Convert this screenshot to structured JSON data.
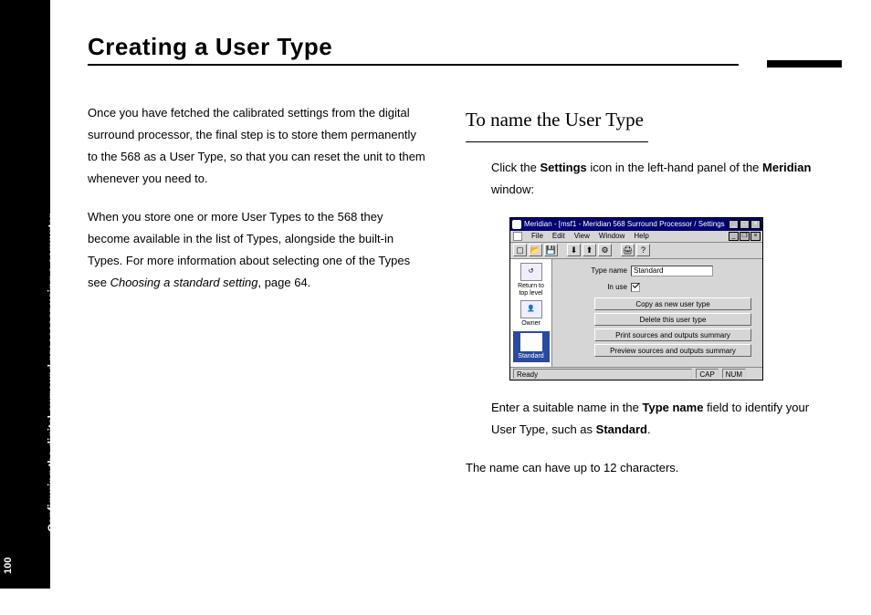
{
  "page_number": "100",
  "sidebar_label": "Configuring the digital surround processor using a computer",
  "heading": "Creating a User Type",
  "left_column": {
    "para1": "Once you have fetched the calibrated settings from the digital surround processor, the final step is to store them permanently to the 568 as a User Type, so that you can reset the unit to them whenever you need to.",
    "para2_prefix": "When you store one or more User Types to the 568 they become available in the list of Types, alongside the built-in Types. For more information about selecting one of the Types see ",
    "para2_italic": "Choosing a standard setting",
    "para2_suffix": ", page 64."
  },
  "right_column": {
    "subheading": "To name the User Type",
    "click_prefix": "Click the ",
    "click_bold1": "Settings",
    "click_mid": " icon in the left-hand panel of the ",
    "click_bold2": "Meridian",
    "click_suffix": " window:",
    "enter_prefix": "Enter a suitable name in the ",
    "enter_bold1": "Type name",
    "enter_mid": " field to identify your User Type, such as ",
    "enter_bold2": "Standard",
    "enter_suffix": ".",
    "limit": "The name can have up to 12 characters."
  },
  "app": {
    "title": "Meridian - [msf1 - Meridian 568 Surround Processor / Settings ]",
    "menu": {
      "file": "File",
      "edit": "Edit",
      "view": "View",
      "window": "Window",
      "help": "Help"
    },
    "form": {
      "type_name_label": "Type name",
      "type_name_value": "Standard",
      "in_use_label": "In use",
      "btn_copy": "Copy as new user type",
      "btn_delete": "Delete this user type",
      "btn_print": "Print sources and outputs summary",
      "btn_preview": "Preview sources and outputs summary"
    },
    "side": {
      "return_label": "Return to top level",
      "owner_label": "Owner",
      "standard_label": "Standard"
    },
    "status": {
      "ready": "Ready",
      "cap": "CAP",
      "num": "NUM"
    }
  }
}
